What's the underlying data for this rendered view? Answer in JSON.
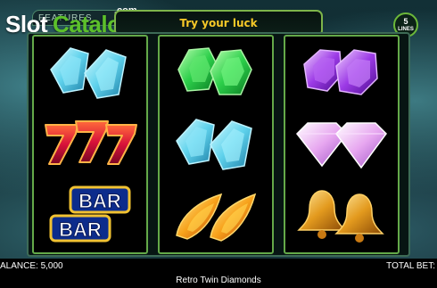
{
  "logo": {
    "slot": "Slot",
    "catalog": "Catalog",
    "com": ".com"
  },
  "features_tab": {
    "label": "FEATURES"
  },
  "banner": {
    "text": "Try your luck"
  },
  "lines_badge": {
    "count": "5",
    "label": "LINES"
  },
  "reels": [
    {
      "symbols": [
        "blue-diamond",
        "triple-seven",
        "double-bar"
      ]
    },
    {
      "symbols": [
        "green-diamond",
        "blue-diamond",
        "orange-gem"
      ]
    },
    {
      "symbols": [
        "purple-diamond",
        "pink-diamond",
        "golden-bells"
      ]
    }
  ],
  "status_bar": {
    "balance": "ALANCE: 5,000",
    "total_bet": "TOTAL BET:",
    "game_title": "Retro Twin Diamonds"
  },
  "colors": {
    "accent_green": "#64a949",
    "banner_text": "#f7c928",
    "logo_green": "#5cc02b"
  }
}
